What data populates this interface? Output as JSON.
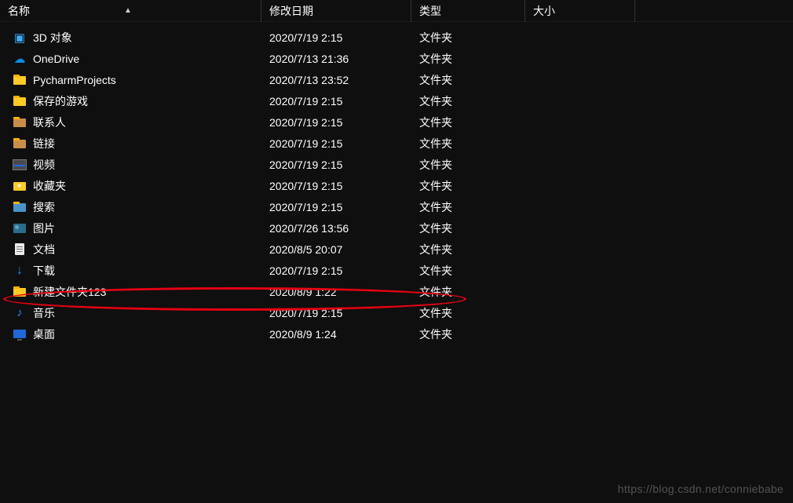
{
  "columns": {
    "name": "名称",
    "date": "修改日期",
    "type": "类型",
    "size": "大小"
  },
  "rows": [
    {
      "icon": "3d",
      "name": "3D 对象",
      "date": "2020/7/19 2:15",
      "type": "文件夹"
    },
    {
      "icon": "onedrive",
      "name": "OneDrive",
      "date": "2020/7/13 21:36",
      "type": "文件夹"
    },
    {
      "icon": "folder",
      "name": "PycharmProjects",
      "date": "2020/7/13 23:52",
      "type": "文件夹"
    },
    {
      "icon": "folder",
      "name": "保存的游戏",
      "date": "2020/7/19 2:15",
      "type": "文件夹"
    },
    {
      "icon": "contacts",
      "name": "联系人",
      "date": "2020/7/19 2:15",
      "type": "文件夹"
    },
    {
      "icon": "links",
      "name": "链接",
      "date": "2020/7/19 2:15",
      "type": "文件夹"
    },
    {
      "icon": "video",
      "name": "视频",
      "date": "2020/7/19 2:15",
      "type": "文件夹"
    },
    {
      "icon": "fav",
      "name": "收藏夹",
      "date": "2020/7/19 2:15",
      "type": "文件夹"
    },
    {
      "icon": "search",
      "name": "搜索",
      "date": "2020/7/19 2:15",
      "type": "文件夹"
    },
    {
      "icon": "pics",
      "name": "图片",
      "date": "2020/7/26 13:56",
      "type": "文件夹"
    },
    {
      "icon": "docs",
      "name": "文档",
      "date": "2020/8/5 20:07",
      "type": "文件夹"
    },
    {
      "icon": "download",
      "name": "下载",
      "date": "2020/7/19 2:15",
      "type": "文件夹"
    },
    {
      "icon": "folder",
      "name": "新建文件夹123",
      "date": "2020/8/9 1:22",
      "type": "文件夹",
      "highlighted": true
    },
    {
      "icon": "music",
      "name": "音乐",
      "date": "2020/7/19 2:15",
      "type": "文件夹"
    },
    {
      "icon": "desktop",
      "name": "桌面",
      "date": "2020/8/9 1:24",
      "type": "文件夹"
    }
  ],
  "annotation": {
    "highlight_color": "#e60012"
  },
  "watermark": "https://blog.csdn.net/conniebabe"
}
